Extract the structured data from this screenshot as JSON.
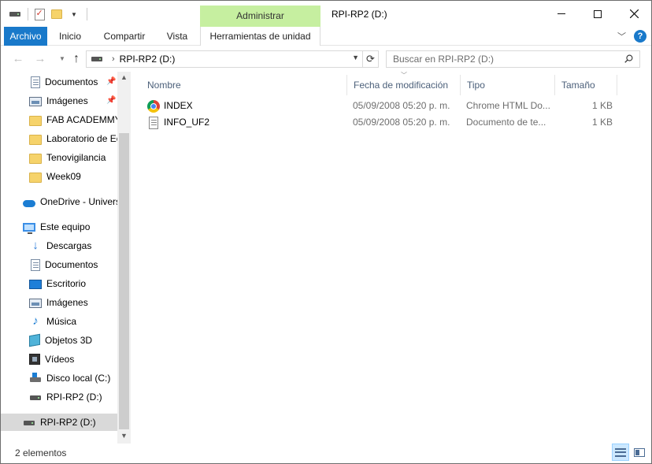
{
  "window": {
    "title": "RPI-RP2 (D:)",
    "context_group": "Administrar"
  },
  "ribbon": {
    "tabs": [
      "Archivo",
      "Inicio",
      "Compartir",
      "Vista",
      "Herramientas de unidad"
    ],
    "active_tab": "Archivo",
    "accent_color": "#1979ca",
    "context_color": "#c6efa0"
  },
  "address": {
    "path": "RPI-RP2 (D:)",
    "search_placeholder": "Buscar en RPI-RP2 (D:)"
  },
  "sidebar": {
    "items": [
      {
        "label": "Documentos",
        "icon": "documents-icon",
        "pinned": true
      },
      {
        "label": "Imágenes",
        "icon": "pictures-icon",
        "pinned": true
      },
      {
        "label": "FAB ACADEMMY",
        "icon": "folder-icon"
      },
      {
        "label": "Laboratorio de Ec",
        "icon": "folder-icon"
      },
      {
        "label": "Tenovigilancia",
        "icon": "folder-icon"
      },
      {
        "label": "Week09",
        "icon": "folder-icon"
      },
      {
        "label": "OneDrive - Univers",
        "icon": "onedrive-icon"
      },
      {
        "label": "Este equipo",
        "icon": "this-pc-icon"
      },
      {
        "label": "Descargas",
        "icon": "downloads-icon"
      },
      {
        "label": "Documentos",
        "icon": "documents-icon"
      },
      {
        "label": "Escritorio",
        "icon": "desktop-icon"
      },
      {
        "label": "Imágenes",
        "icon": "pictures-icon"
      },
      {
        "label": "Música",
        "icon": "music-icon"
      },
      {
        "label": "Objetos 3D",
        "icon": "3d-objects-icon"
      },
      {
        "label": "Vídeos",
        "icon": "videos-icon"
      },
      {
        "label": "Disco local (C:)",
        "icon": "local-disk-icon"
      },
      {
        "label": "RPI-RP2 (D:)",
        "icon": "usb-drive-icon"
      },
      {
        "label": "RPI-RP2 (D:)",
        "icon": "usb-drive-icon",
        "selected": true
      }
    ]
  },
  "columns": {
    "name": "Nombre",
    "date": "Fecha de modificación",
    "type": "Tipo",
    "size": "Tamaño"
  },
  "files": [
    {
      "name": "INDEX",
      "date": "05/09/2008 05:20 p. m.",
      "type": "Chrome HTML Do...",
      "size": "1 KB",
      "icon": "chrome-html-icon"
    },
    {
      "name": "INFO_UF2",
      "date": "05/09/2008 05:20 p. m.",
      "type": "Documento de te...",
      "size": "1 KB",
      "icon": "text-file-icon"
    }
  ],
  "status": {
    "item_count": "2 elementos"
  }
}
